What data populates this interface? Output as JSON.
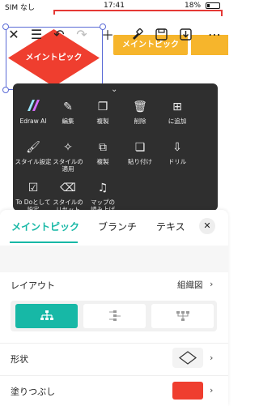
{
  "status_bar": {
    "carrier": "SIM なし",
    "time": "17:41",
    "battery": "18%"
  },
  "toolbar": {
    "icons": [
      "close-icon",
      "list-icon",
      "undo-icon",
      "redo-icon",
      "add-icon",
      "format-painter-icon",
      "save-icon",
      "download-icon",
      "more-icon"
    ]
  },
  "canvas": {
    "main_topic_label": "メイントピック",
    "orange_topic_label": "メイントピック",
    "colors": {
      "diamond": "#ef3e2f",
      "orange": "#f6b52c",
      "selection": "#5b6bd6"
    }
  },
  "context_menu": {
    "items": [
      {
        "label": "Edraw AI",
        "icon": "edraw-ai-icon"
      },
      {
        "label": "編集",
        "icon": "edit-icon"
      },
      {
        "label": "複製",
        "icon": "duplicate-icon"
      },
      {
        "label": "削除",
        "icon": "delete-icon"
      },
      {
        "label": "に追加",
        "icon": "add-box-icon"
      },
      {
        "label": "スタイル設定",
        "icon": "style-brush-icon"
      },
      {
        "label": "スタイルの",
        "label2": "適用",
        "icon": "magic-wand-icon"
      },
      {
        "label": "複製",
        "icon": "copy-icon"
      },
      {
        "label": "貼り付け",
        "icon": "paste-icon"
      },
      {
        "label": "ドリル",
        "icon": "drill-icon"
      },
      {
        "label": "To Doとして",
        "label2": "設定",
        "icon": "todo-icon"
      },
      {
        "label": "スタイルの",
        "label2": "リセット",
        "icon": "reset-style-icon"
      },
      {
        "label": "マップの",
        "label2": "読み上げ",
        "icon": "read-aloud-icon"
      }
    ]
  },
  "panel": {
    "tabs": [
      "メイントピック",
      "ブランチ",
      "テキス"
    ],
    "active_tab": 0,
    "layout": {
      "label": "レイアウト",
      "value": "組織図"
    },
    "shape": {
      "label": "形状"
    },
    "fill": {
      "label": "塗りつぶし",
      "color": "#ef3e2f"
    },
    "accent": "#17b8a6"
  }
}
